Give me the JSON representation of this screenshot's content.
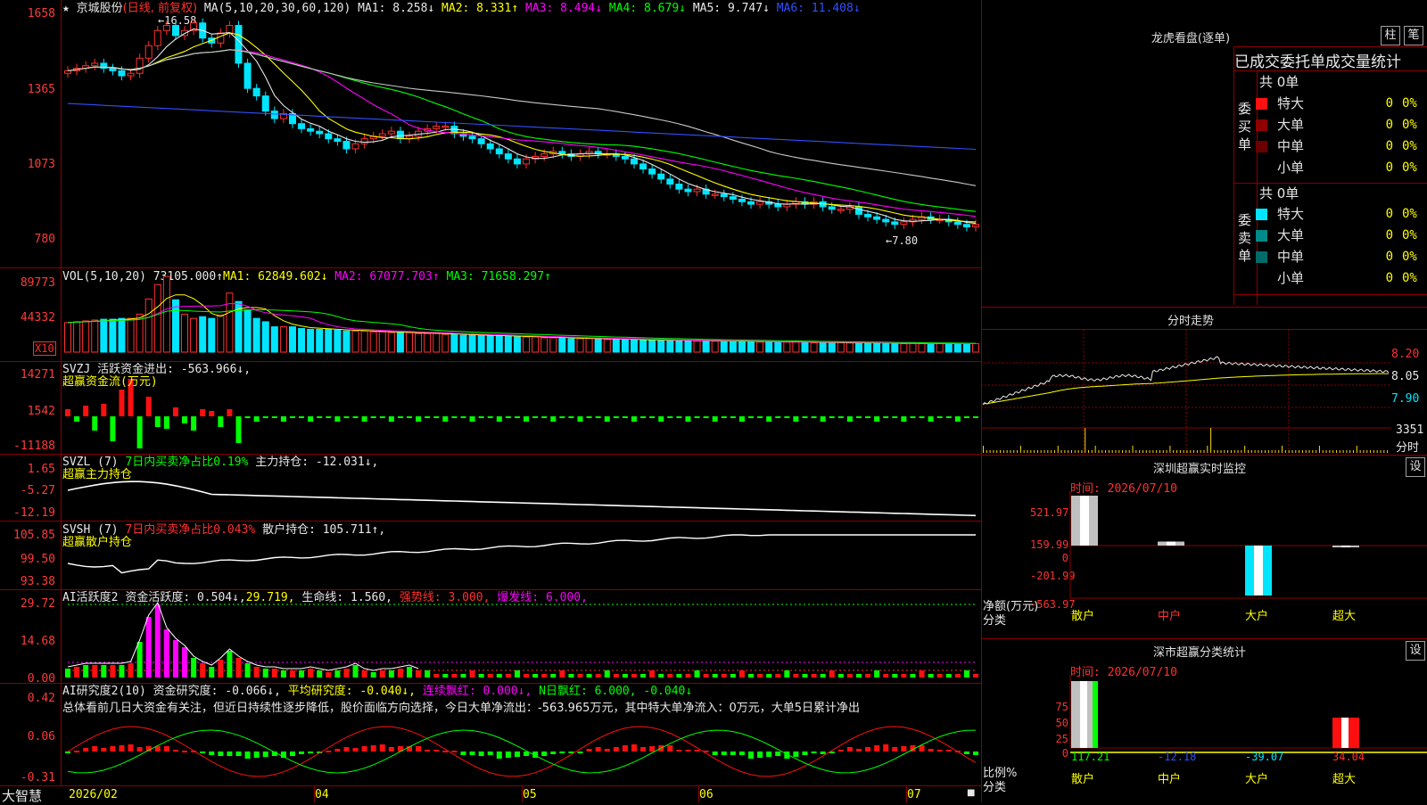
{
  "stock": {
    "name": "京城股份",
    "period": "(日线, 前复权)",
    "ma_label": "MA(5,10,20,30,60,120)",
    "ma_values": [
      "MA1: 8.258↓",
      "MA2: 8.331↑",
      "MA3: 8.494↓",
      "MA4: 8.679↓",
      "MA5: 9.747↓",
      "MA6: 11.408↓"
    ],
    "high_marker": "←16.58",
    "low_marker": "←7.80",
    "star": "★"
  },
  "price_axis": [
    "1658",
    "1365",
    "1073",
    "780"
  ],
  "vol": {
    "label": "VOL(5,10,20)",
    "value": "73105.000↑",
    "ma": [
      "MA1: 62849.602↓",
      "MA2: 67077.703↑",
      "MA3: 71658.297↑"
    ],
    "axis": [
      "89773",
      "44332"
    ],
    "unit": "X10"
  },
  "svzj": {
    "title": "SVZJ",
    "line1": "活跃资金进出: -563.966↓,",
    "line2": "超赢资金流(万元)",
    "axis": [
      "14271",
      "1542",
      "-11188"
    ]
  },
  "svzl": {
    "title": "SVZL (7)",
    "ratio": "7日内买卖净占比0.19%",
    "pos": "主力持仓: -12.031↓,",
    "line2": "超赢主力持仓",
    "axis": [
      "1.65",
      "-5.27",
      "-12.19"
    ]
  },
  "svsh": {
    "title": "SVSH (7)",
    "ratio": "7日内买卖净占比0.043%",
    "pos": "散户持仓: 105.711↑,",
    "line2": "超赢散户持仓",
    "axis": [
      "105.85",
      "99.50",
      "93.38"
    ]
  },
  "aihy": {
    "title": "AI活跃度2",
    "v1": "资金活跃度: 0.504↓,",
    "v2": "29.719,",
    "v3": "生命线: 1.560,",
    "v4": "强势线: 3.000,",
    "v5": "爆发线: 6.000,",
    "axis": [
      "29.72",
      "14.68",
      "0.00"
    ]
  },
  "aiyj": {
    "title": "AI研究度2(10)",
    "v1": "资金研究度: -0.066↓,",
    "v2": "平均研究度: -0.040↓,",
    "v3": "连续飘红: 0.000↓,",
    "v4": "N日飘红: 6.000, -0.040↓",
    "comment": "总体看前几日大资金有关注，但近日持续性逐步降低，股价面临方向选择，今日大单净流出：-563.965万元，其中特大单净流入：0万元，大单5日累计净出",
    "axis": [
      "0.42",
      "0.06",
      "-0.31"
    ]
  },
  "xaxis": {
    "brand": "大智慧",
    "labels": [
      "2026/02",
      "04",
      "05",
      "06",
      "07"
    ]
  },
  "lhkp": {
    "title": "龙虎看盘(逐单)",
    "btn1": "柱",
    "btn2": "笔",
    "header": "已成交委托单成交量统计",
    "buy_total": "共 0单",
    "sell_total": "共 0单",
    "buy_label": [
      "委",
      "买",
      "单"
    ],
    "sell_label": [
      "委",
      "卖",
      "单"
    ],
    "rows": [
      "特大",
      "大单",
      "中单",
      "小单"
    ],
    "count": "0",
    "pct": "0%"
  },
  "fszs": {
    "title": "分时走势",
    "axis": [
      "8.20",
      "8.05",
      "7.90"
    ],
    "vol_val": "3351",
    "vol_lab": "分时"
  },
  "szcy": {
    "title": "深圳超赢实时监控",
    "btn": "设",
    "time": "时间: 2026/07/10",
    "axis": [
      "521.97",
      "159.99",
      "0",
      "-201.99",
      "-563.97"
    ],
    "ylab1": "净额(万元)",
    "ylab2": "分类",
    "categories": [
      "散户",
      "中户",
      "大户",
      "超大"
    ],
    "labels": [
      "521.97",
      "42",
      "-563.97",
      "0"
    ]
  },
  "scfl": {
    "title": "深市超赢分类统计",
    "btn": "设",
    "time": "时间: 2026/07/10",
    "axis": [
      "75",
      "50",
      "25",
      "0"
    ],
    "ylab1": "比例%",
    "ylab2": "分类",
    "categories": [
      "散户",
      "中户",
      "大户",
      "超大"
    ],
    "labels": [
      "117.21",
      "-12.18",
      "-39.07",
      "34.04"
    ]
  },
  "chart_data": [
    {
      "type": "candlestick",
      "title": "京城股份 (日线, 前复权)",
      "x": [
        "2026/02",
        "04",
        "05",
        "06",
        "07"
      ],
      "close": [
        14.3,
        14.4,
        14.5,
        14.6,
        14.4,
        14.3,
        14.1,
        14.2,
        14.8,
        15.3,
        15.9,
        16.1,
        15.7,
        15.9,
        16.2,
        15.6,
        15.4,
        15.8,
        16.1,
        14.6,
        13.6,
        13.3,
        12.7,
        12.4,
        12.6,
        12.2,
        12.0,
        11.9,
        11.8,
        11.6,
        11.5,
        11.2,
        11.4,
        11.6,
        11.7,
        11.8,
        11.9,
        11.6,
        11.7,
        11.9,
        12.0,
        12.1,
        12.1,
        11.8,
        11.7,
        11.6,
        11.4,
        11.2,
        11.0,
        10.8,
        10.6,
        10.8,
        10.9,
        11.0,
        11.1,
        11.0,
        10.9,
        11.0,
        11.1,
        11.0,
        11.0,
        10.9,
        10.8,
        10.6,
        10.4,
        10.2,
        10.0,
        9.8,
        9.6,
        9.5,
        9.6,
        9.4,
        9.4,
        9.3,
        9.2,
        9.1,
        9.0,
        9.1,
        9.0,
        8.9,
        9.0,
        9.1,
        9.0,
        9.1,
        8.9,
        8.8,
        8.8,
        8.9,
        8.6,
        8.5,
        8.4,
        8.3,
        8.2,
        8.3,
        8.4,
        8.5,
        8.4,
        8.4,
        8.3,
        8.2,
        8.1,
        8.2
      ]
    },
    {
      "type": "bar",
      "title": "VOL(5,10,20)",
      "values": [
        35000,
        36000,
        37000,
        38000,
        39000,
        39000,
        40000,
        40000,
        45000,
        63000,
        80000,
        89773,
        62000,
        45000,
        40000,
        42000,
        40000,
        44000,
        70000,
        60000,
        50000,
        40000,
        36000,
        30000,
        30000,
        30000,
        28000,
        27000,
        27000,
        27000,
        26000,
        25000,
        25000,
        25000,
        24000,
        24000,
        23000,
        23000,
        23000,
        22000,
        22000,
        22000,
        21000,
        21000,
        20000,
        20000,
        20000,
        19000,
        19000,
        19000,
        18000,
        18000,
        18000,
        17000,
        17000,
        17000,
        16000,
        16000,
        16000,
        16000,
        15000,
        15000,
        15000,
        15000,
        14000,
        14000,
        14000,
        14000,
        14000,
        14000,
        13000,
        13000,
        13000,
        13000,
        13000,
        13000,
        12000,
        12000,
        12000,
        12000,
        12000,
        12000,
        12000,
        11000,
        11000,
        11000,
        11000,
        11000,
        11000,
        11000,
        11000,
        10000,
        10000,
        10000,
        10000,
        10000,
        10000,
        10000,
        10000,
        10000,
        10000,
        10000
      ],
      "ylim": [
        0,
        89773
      ]
    },
    {
      "type": "bar",
      "title": "深圳超赢实时监控",
      "categories": [
        "散户",
        "中户",
        "大户",
        "超大"
      ],
      "values": [
        521.97,
        42,
        -563.97,
        0
      ],
      "ylim": [
        -563.97,
        521.97
      ]
    },
    {
      "type": "bar",
      "title": "深市超赢分类统计",
      "categories": [
        "散户",
        "中户",
        "大户",
        "超大"
      ],
      "values": [
        117.21,
        -12.18,
        -39.07,
        34.04
      ],
      "ylim": [
        0,
        75
      ]
    }
  ]
}
